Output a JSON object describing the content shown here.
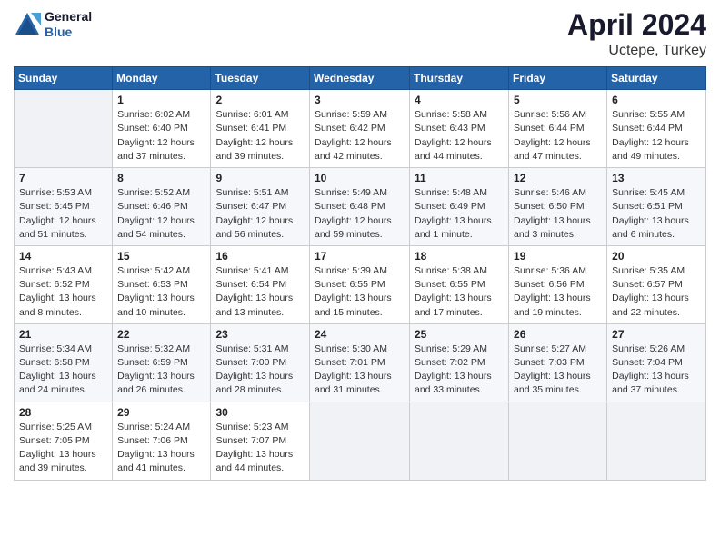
{
  "header": {
    "logo_line1": "General",
    "logo_line2": "Blue",
    "title": "April 2024",
    "subtitle": "Uctepe, Turkey"
  },
  "days_of_week": [
    "Sunday",
    "Monday",
    "Tuesday",
    "Wednesday",
    "Thursday",
    "Friday",
    "Saturday"
  ],
  "weeks": [
    [
      {
        "day": "",
        "info": ""
      },
      {
        "day": "1",
        "info": "Sunrise: 6:02 AM\nSunset: 6:40 PM\nDaylight: 12 hours\nand 37 minutes."
      },
      {
        "day": "2",
        "info": "Sunrise: 6:01 AM\nSunset: 6:41 PM\nDaylight: 12 hours\nand 39 minutes."
      },
      {
        "day": "3",
        "info": "Sunrise: 5:59 AM\nSunset: 6:42 PM\nDaylight: 12 hours\nand 42 minutes."
      },
      {
        "day": "4",
        "info": "Sunrise: 5:58 AM\nSunset: 6:43 PM\nDaylight: 12 hours\nand 44 minutes."
      },
      {
        "day": "5",
        "info": "Sunrise: 5:56 AM\nSunset: 6:44 PM\nDaylight: 12 hours\nand 47 minutes."
      },
      {
        "day": "6",
        "info": "Sunrise: 5:55 AM\nSunset: 6:44 PM\nDaylight: 12 hours\nand 49 minutes."
      }
    ],
    [
      {
        "day": "7",
        "info": "Sunrise: 5:53 AM\nSunset: 6:45 PM\nDaylight: 12 hours\nand 51 minutes."
      },
      {
        "day": "8",
        "info": "Sunrise: 5:52 AM\nSunset: 6:46 PM\nDaylight: 12 hours\nand 54 minutes."
      },
      {
        "day": "9",
        "info": "Sunrise: 5:51 AM\nSunset: 6:47 PM\nDaylight: 12 hours\nand 56 minutes."
      },
      {
        "day": "10",
        "info": "Sunrise: 5:49 AM\nSunset: 6:48 PM\nDaylight: 12 hours\nand 59 minutes."
      },
      {
        "day": "11",
        "info": "Sunrise: 5:48 AM\nSunset: 6:49 PM\nDaylight: 13 hours\nand 1 minute."
      },
      {
        "day": "12",
        "info": "Sunrise: 5:46 AM\nSunset: 6:50 PM\nDaylight: 13 hours\nand 3 minutes."
      },
      {
        "day": "13",
        "info": "Sunrise: 5:45 AM\nSunset: 6:51 PM\nDaylight: 13 hours\nand 6 minutes."
      }
    ],
    [
      {
        "day": "14",
        "info": "Sunrise: 5:43 AM\nSunset: 6:52 PM\nDaylight: 13 hours\nand 8 minutes."
      },
      {
        "day": "15",
        "info": "Sunrise: 5:42 AM\nSunset: 6:53 PM\nDaylight: 13 hours\nand 10 minutes."
      },
      {
        "day": "16",
        "info": "Sunrise: 5:41 AM\nSunset: 6:54 PM\nDaylight: 13 hours\nand 13 minutes."
      },
      {
        "day": "17",
        "info": "Sunrise: 5:39 AM\nSunset: 6:55 PM\nDaylight: 13 hours\nand 15 minutes."
      },
      {
        "day": "18",
        "info": "Sunrise: 5:38 AM\nSunset: 6:55 PM\nDaylight: 13 hours\nand 17 minutes."
      },
      {
        "day": "19",
        "info": "Sunrise: 5:36 AM\nSunset: 6:56 PM\nDaylight: 13 hours\nand 19 minutes."
      },
      {
        "day": "20",
        "info": "Sunrise: 5:35 AM\nSunset: 6:57 PM\nDaylight: 13 hours\nand 22 minutes."
      }
    ],
    [
      {
        "day": "21",
        "info": "Sunrise: 5:34 AM\nSunset: 6:58 PM\nDaylight: 13 hours\nand 24 minutes."
      },
      {
        "day": "22",
        "info": "Sunrise: 5:32 AM\nSunset: 6:59 PM\nDaylight: 13 hours\nand 26 minutes."
      },
      {
        "day": "23",
        "info": "Sunrise: 5:31 AM\nSunset: 7:00 PM\nDaylight: 13 hours\nand 28 minutes."
      },
      {
        "day": "24",
        "info": "Sunrise: 5:30 AM\nSunset: 7:01 PM\nDaylight: 13 hours\nand 31 minutes."
      },
      {
        "day": "25",
        "info": "Sunrise: 5:29 AM\nSunset: 7:02 PM\nDaylight: 13 hours\nand 33 minutes."
      },
      {
        "day": "26",
        "info": "Sunrise: 5:27 AM\nSunset: 7:03 PM\nDaylight: 13 hours\nand 35 minutes."
      },
      {
        "day": "27",
        "info": "Sunrise: 5:26 AM\nSunset: 7:04 PM\nDaylight: 13 hours\nand 37 minutes."
      }
    ],
    [
      {
        "day": "28",
        "info": "Sunrise: 5:25 AM\nSunset: 7:05 PM\nDaylight: 13 hours\nand 39 minutes."
      },
      {
        "day": "29",
        "info": "Sunrise: 5:24 AM\nSunset: 7:06 PM\nDaylight: 13 hours\nand 41 minutes."
      },
      {
        "day": "30",
        "info": "Sunrise: 5:23 AM\nSunset: 7:07 PM\nDaylight: 13 hours\nand 44 minutes."
      },
      {
        "day": "",
        "info": ""
      },
      {
        "day": "",
        "info": ""
      },
      {
        "day": "",
        "info": ""
      },
      {
        "day": "",
        "info": ""
      }
    ]
  ]
}
